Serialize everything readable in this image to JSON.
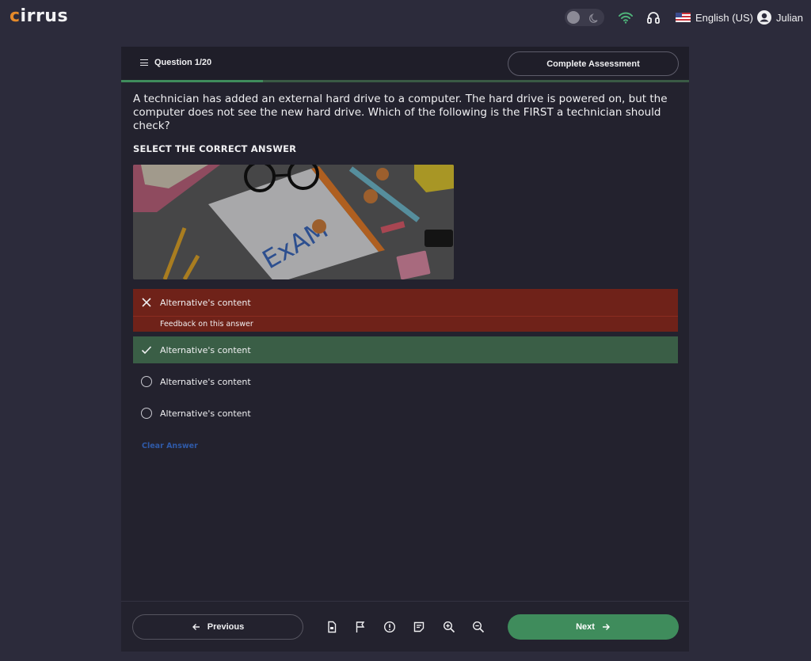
{
  "brand": {
    "logo_text": "cirrus",
    "accent_color": "#e58a2a"
  },
  "topbar": {
    "theme_toggle": {
      "state": "light",
      "icon": "moon-icon"
    },
    "icons": [
      "wifi-icon",
      "headphones-icon"
    ],
    "language": "English (US)",
    "user_name": "Julian"
  },
  "assessment": {
    "question_counter": "Question 1/20",
    "complete_label": "Complete Assessment",
    "progress_fraction": 0.25,
    "question_text": "A technician has added an external hard drive to a computer. The hard drive is powered on, but the computer does not see the new hard drive. Which of the following is the FIRST a technician should check?",
    "instruction": "SELECT THE CORRECT ANSWER",
    "image_word": "ExAM",
    "alternatives": [
      {
        "label": "Alternative's content",
        "state": "incorrect",
        "feedback": "Feedback on this answer"
      },
      {
        "label": "Alternative's content",
        "state": "correct"
      },
      {
        "label": "Alternative's content",
        "state": "unselected"
      },
      {
        "label": "Alternative's content",
        "state": "unselected"
      }
    ],
    "clear_label": "Clear Answer"
  },
  "footer": {
    "previous_label": "Previous",
    "next_label": "Next",
    "tools": [
      "document-icon",
      "flag-icon",
      "alert-icon",
      "note-icon",
      "zoom-in-icon",
      "zoom-out-icon"
    ]
  },
  "colors": {
    "background": "#2c2b3b",
    "panel": "#23222e",
    "incorrect": "#6f2219",
    "correct": "#3a5e46",
    "primary_green": "#3f8c5c",
    "link_blue": "#2f5aa8"
  }
}
